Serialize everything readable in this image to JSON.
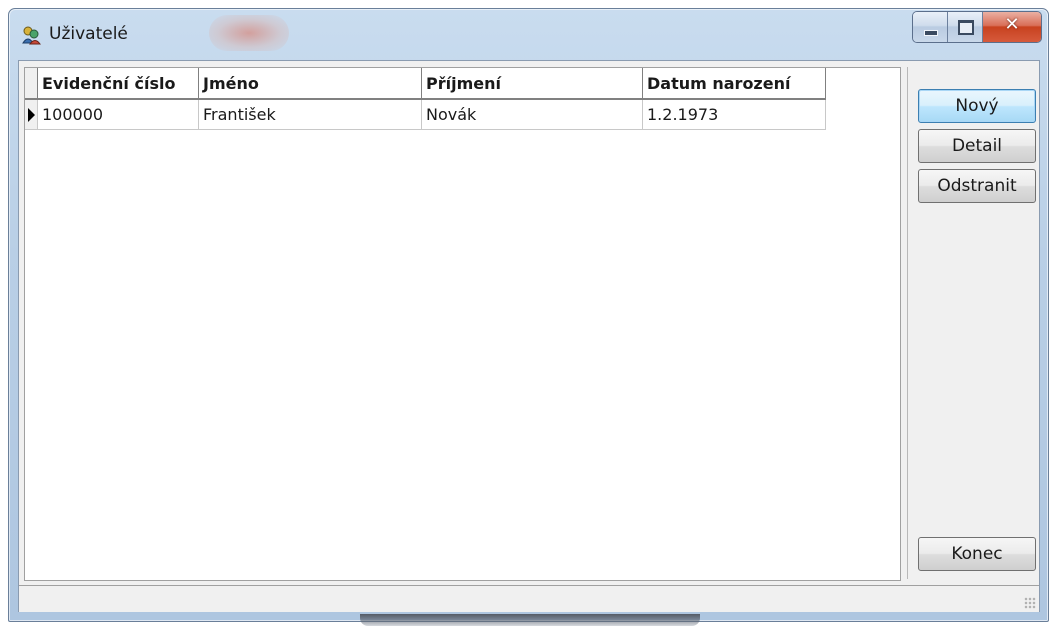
{
  "window": {
    "title": "Uživatelé",
    "icon": "users-app-icon"
  },
  "caption_buttons": {
    "minimize": "minimize-icon",
    "maximize": "maximize-icon",
    "close": "close-icon"
  },
  "table": {
    "columns": [
      "Evidenční číslo",
      "Jméno",
      "Příjmení",
      "Datum narození"
    ],
    "rows": [
      {
        "selected": true,
        "cells": [
          "100000",
          "František",
          "Novák",
          "1.2.1973"
        ]
      }
    ]
  },
  "buttons": {
    "new": "Nový",
    "detail": "Detail",
    "remove": "Odstranit",
    "close": "Konec"
  },
  "colors": {
    "title_bar": "#b9cfe6",
    "close_button": "#c8421f",
    "default_button_border": "#3c7fb1"
  }
}
